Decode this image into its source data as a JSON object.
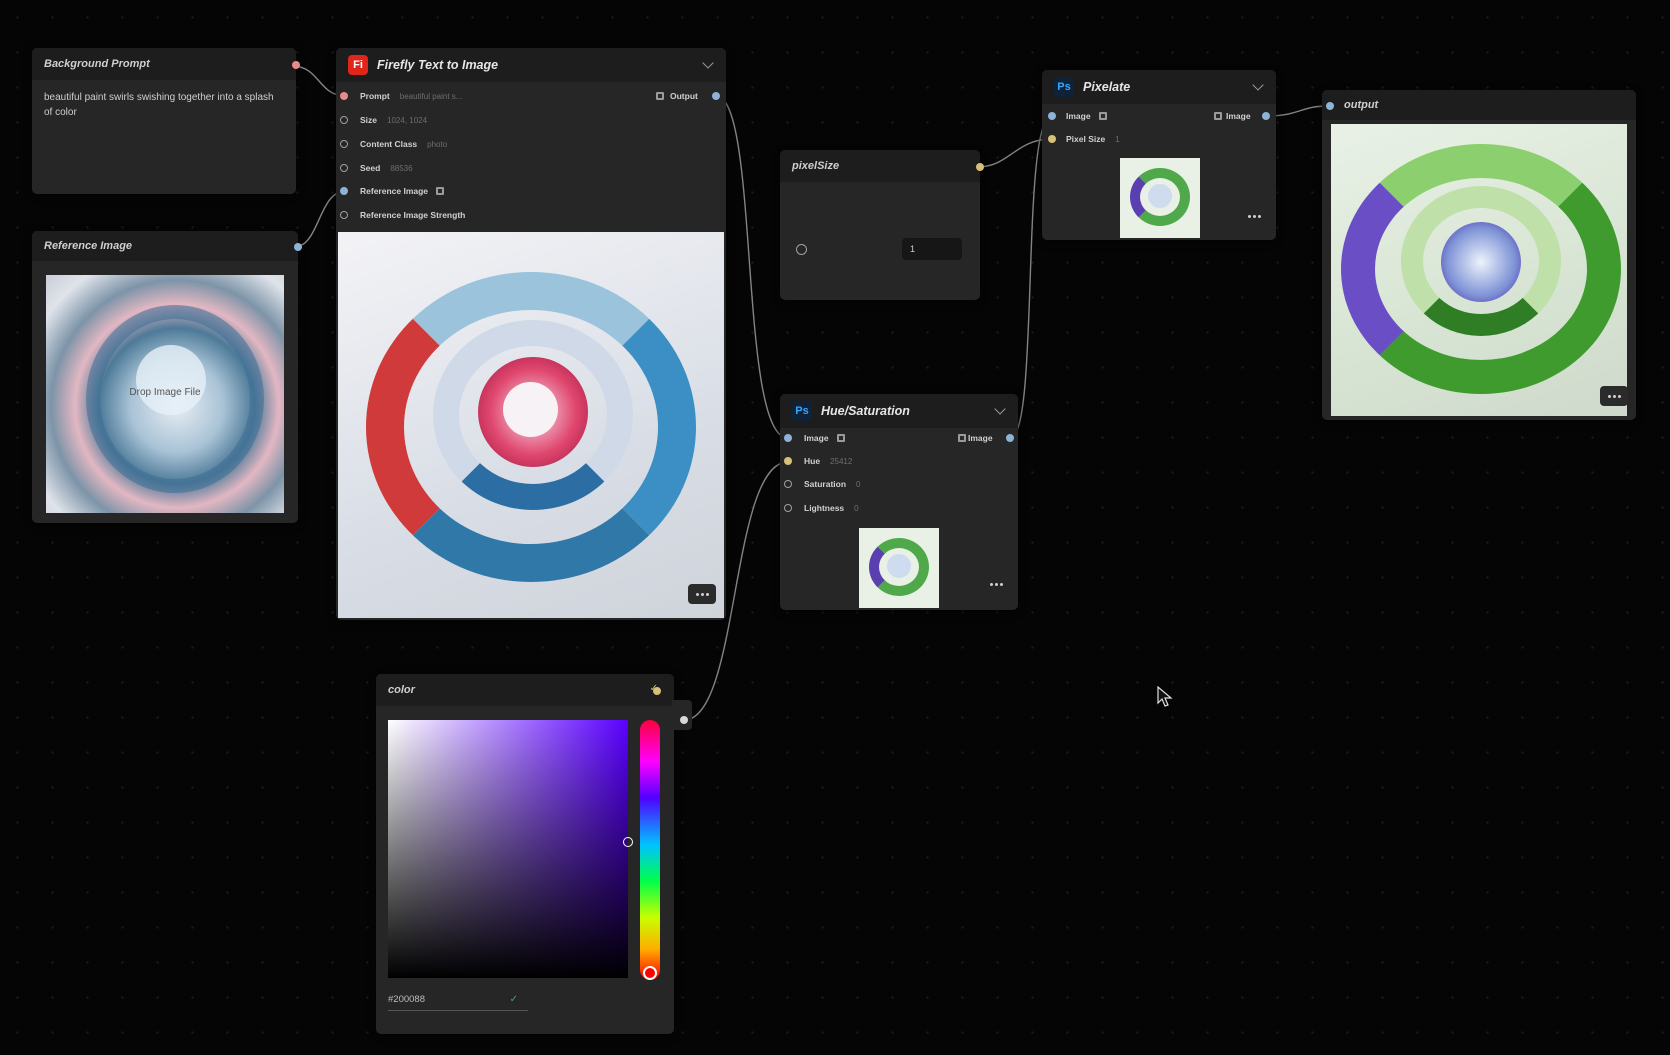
{
  "nodes": {
    "background_prompt": {
      "title": "Background Prompt",
      "text": "beautiful paint swirls swishing together into a splash of color"
    },
    "reference_image": {
      "title": "Reference Image",
      "drop_label": "Drop Image File"
    },
    "firefly": {
      "app": "Fi",
      "title": "Firefly Text to Image",
      "output_label": "Output",
      "params": [
        {
          "label": "Prompt",
          "value": "beautiful paint s..."
        },
        {
          "label": "Size",
          "value": "1024, 1024"
        },
        {
          "label": "Content Class",
          "value": "photo"
        },
        {
          "label": "Seed",
          "value": "88536"
        },
        {
          "label": "Reference Image",
          "value": ""
        },
        {
          "label": "Reference Image Strength",
          "value": ""
        }
      ]
    },
    "pixel_size": {
      "title": "pixelSize",
      "value": "1"
    },
    "pixelate": {
      "app": "Ps",
      "title": "Pixelate",
      "input_label": "Image",
      "output_label": "Image",
      "param_label": "Pixel Size",
      "param_value": "1"
    },
    "hue_saturation": {
      "app": "Ps",
      "title": "Hue/Saturation",
      "input_label": "Image",
      "output_label": "Image",
      "params": [
        {
          "label": "Hue",
          "value": "25412"
        },
        {
          "label": "Saturation",
          "value": "0"
        },
        {
          "label": "Lightness",
          "value": "0"
        }
      ]
    },
    "output": {
      "title": "output"
    },
    "color": {
      "title": "color",
      "hex": "#200088",
      "base_hue_color": "#5a00ff"
    }
  },
  "colors": {
    "port_blue": "#8fb3d6",
    "port_pink": "#e88a8a",
    "port_yellow": "#d8c07a",
    "node_bg": "#262626",
    "canvas_bg": "#050505"
  },
  "icons": [
    "chevron-down-icon",
    "more-icon",
    "image-port-icon",
    "checkmark-icon",
    "cursor-icon"
  ]
}
